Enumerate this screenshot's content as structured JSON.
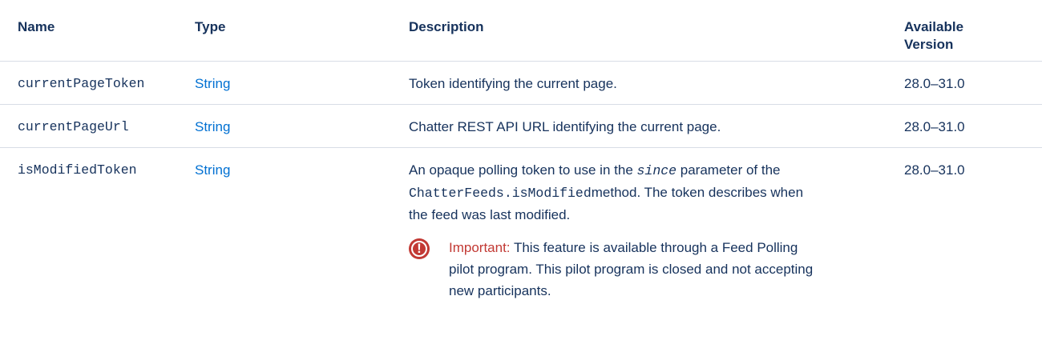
{
  "table": {
    "headers": {
      "name": "Name",
      "type": "Type",
      "description": "Description",
      "version_line1": "Available",
      "version_line2": "Version"
    },
    "rows": [
      {
        "name": "currentPageToken",
        "type": "String",
        "description": "Token identifying the current page.",
        "version": "28.0–31.0"
      },
      {
        "name": "currentPageUrl",
        "type": "String",
        "description": "Chatter REST API URL identifying the current page.",
        "version": "28.0–31.0"
      },
      {
        "name": "isModifiedToken",
        "type": "String",
        "description_parts": {
          "p1": "An opaque polling token to use in the",
          "param": "since",
          "p2": "parameter of the",
          "method": "ChatterFeeds.isModified",
          "p3": "method. The token describes when the feed was last modified."
        },
        "note": {
          "icon": "important-icon",
          "label": "Important:",
          "text": "This feature is available through a Feed Polling pilot program. This pilot program is closed and not accepting new participants."
        },
        "version": "28.0–31.0"
      }
    ]
  },
  "colors": {
    "text": "#16325c",
    "link": "#0070d2",
    "important": "#c23934",
    "border": "#d8dde6"
  }
}
